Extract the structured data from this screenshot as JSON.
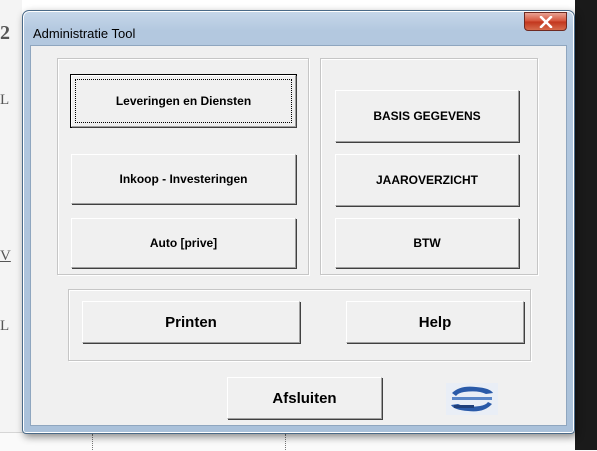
{
  "background": {
    "left_fragments": [
      "2",
      "L",
      "V",
      "L"
    ]
  },
  "window": {
    "title": "Administratie Tool",
    "close_glyph": "x"
  },
  "left_group": {
    "buttons": [
      {
        "label": "Leveringen en Diensten",
        "focused": true
      },
      {
        "label": "Inkoop - Investeringen",
        "focused": false
      },
      {
        "label": "Auto [prive]",
        "focused": false
      }
    ]
  },
  "right_group": {
    "buttons": [
      {
        "label": "BASIS GEGEVENS"
      },
      {
        "label": "JAAROVERZICHT"
      },
      {
        "label": "BTW"
      }
    ]
  },
  "action_group": {
    "print_label": "Printen",
    "help_label": "Help"
  },
  "footer": {
    "exit_label": "Afsluiten",
    "logo_icon": "company-logo-icon"
  },
  "colors": {
    "close_red": "#c2361d",
    "frame_blue": "#b3c8df",
    "logo_blue": "#2a5aa8"
  }
}
